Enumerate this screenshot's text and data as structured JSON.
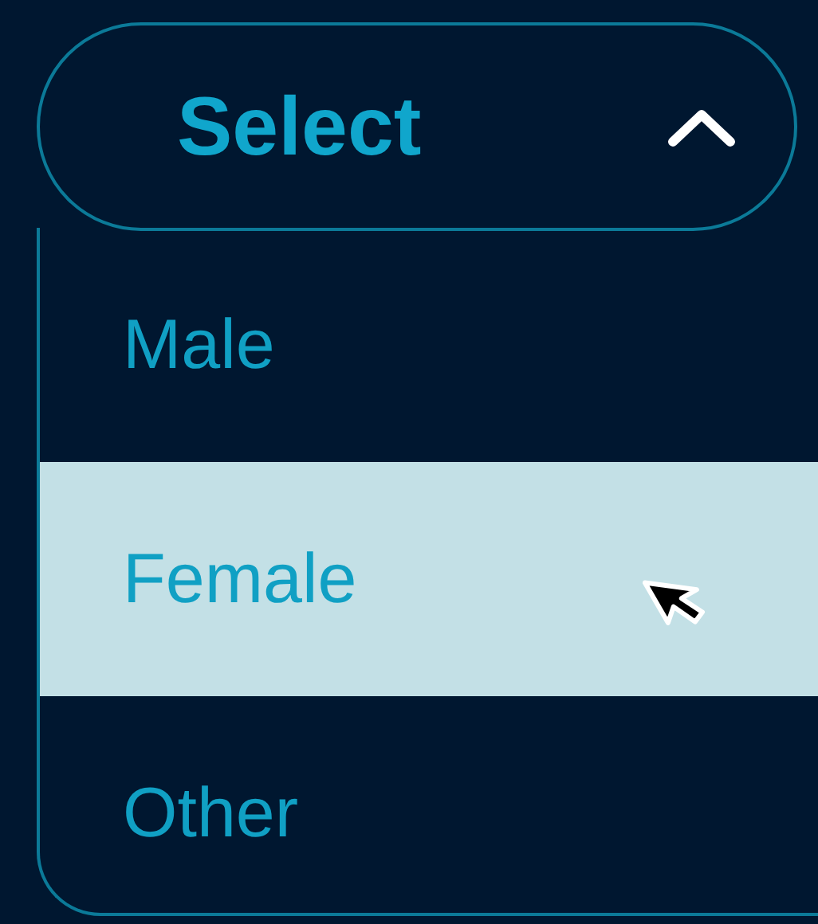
{
  "select": {
    "label": "Select",
    "expanded": true
  },
  "options": [
    {
      "label": "Male",
      "selected": false
    },
    {
      "label": "Female",
      "selected": true
    },
    {
      "label": "Other",
      "selected": false
    }
  ]
}
